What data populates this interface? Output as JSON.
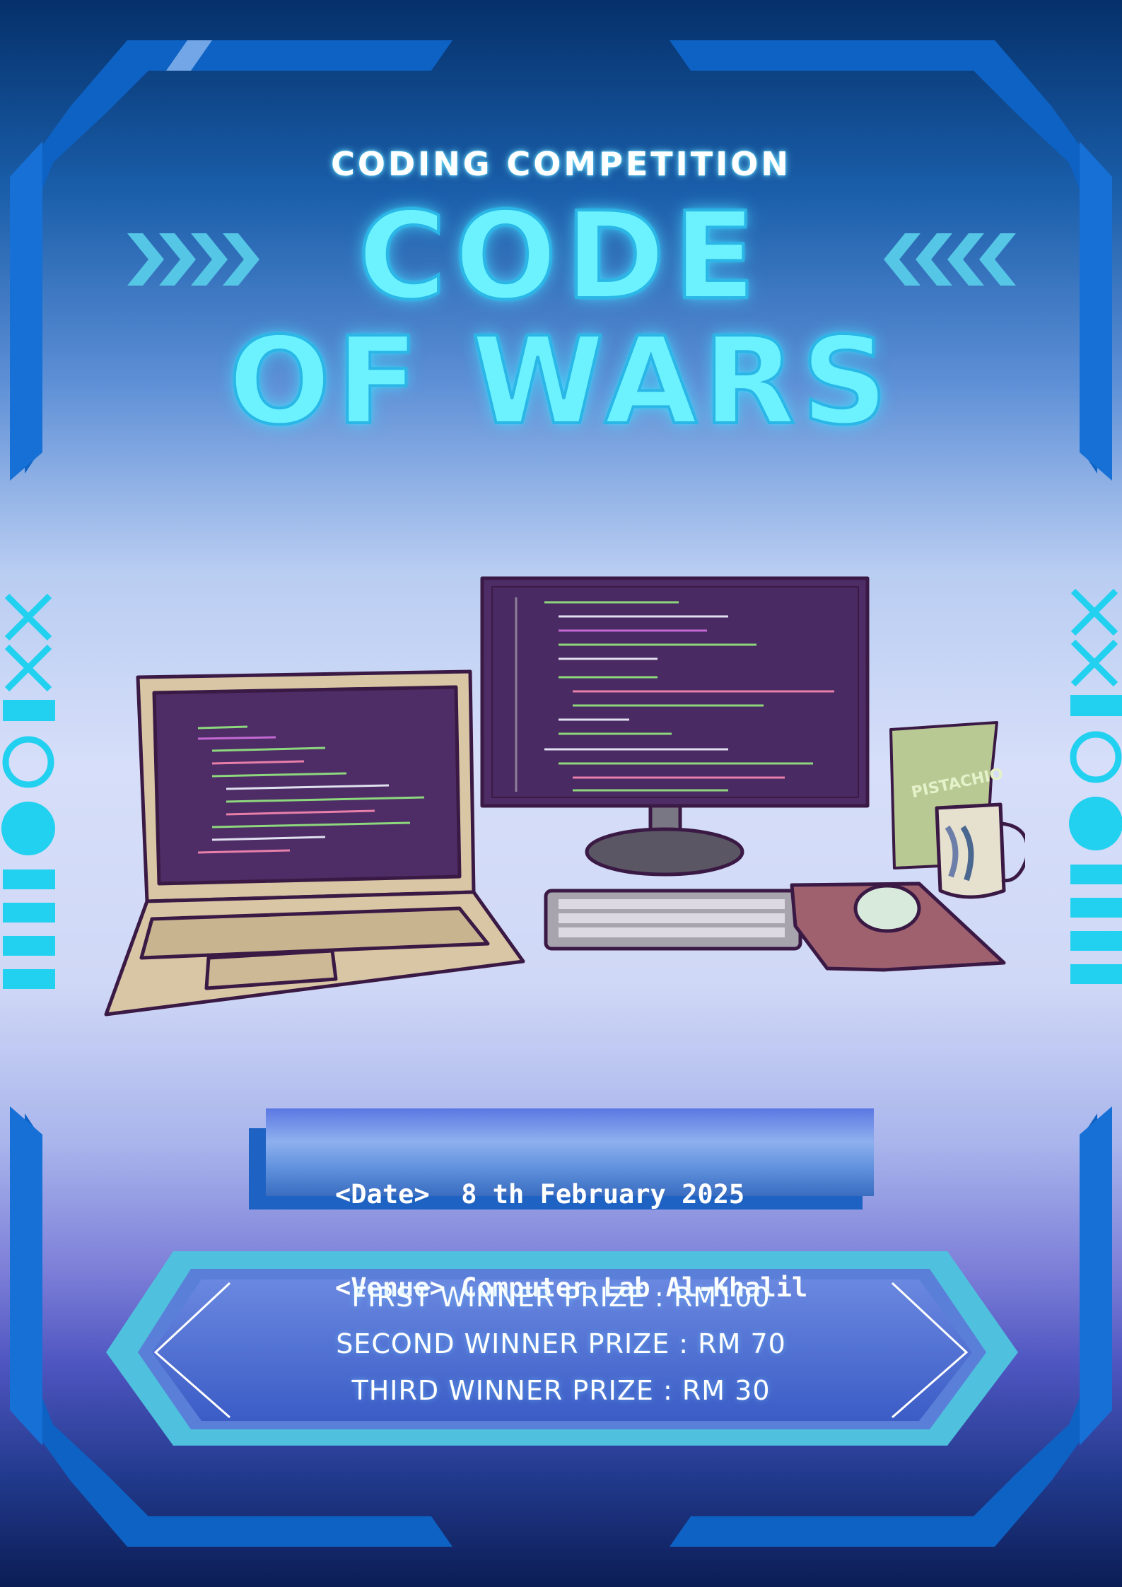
{
  "poster": {
    "subtitle": "CODING COMPETITION",
    "title_line_1": "CODE",
    "title_line_2": "OF WARS"
  },
  "details": {
    "date_tag": "<Date>",
    "date_value": "8 th February 2025",
    "venue_tag": "<Venue>",
    "venue_value": "Computer Lab Al-Khalil"
  },
  "prizes": [
    "FIRST WINNER PRIZE : RM100",
    "SECOND WINNER PRIZE : RM 70",
    "THIRD WINNER PRIZE : RM 30"
  ],
  "illustration": {
    "snack_bag_label": "PISTACHIO"
  },
  "colors": {
    "neon_cyan": "#6cf2ff",
    "frame_blue": "#0d62c4",
    "screen_purple": "#4e2d66",
    "laptop_beige": "#d9c6a5",
    "mousepad_red": "#a0616f"
  },
  "icons": [
    "chevrons-right-icon",
    "chevrons-left-icon",
    "cross-icon",
    "circle-outline-icon",
    "filled-circle-icon",
    "bar-icon"
  ]
}
